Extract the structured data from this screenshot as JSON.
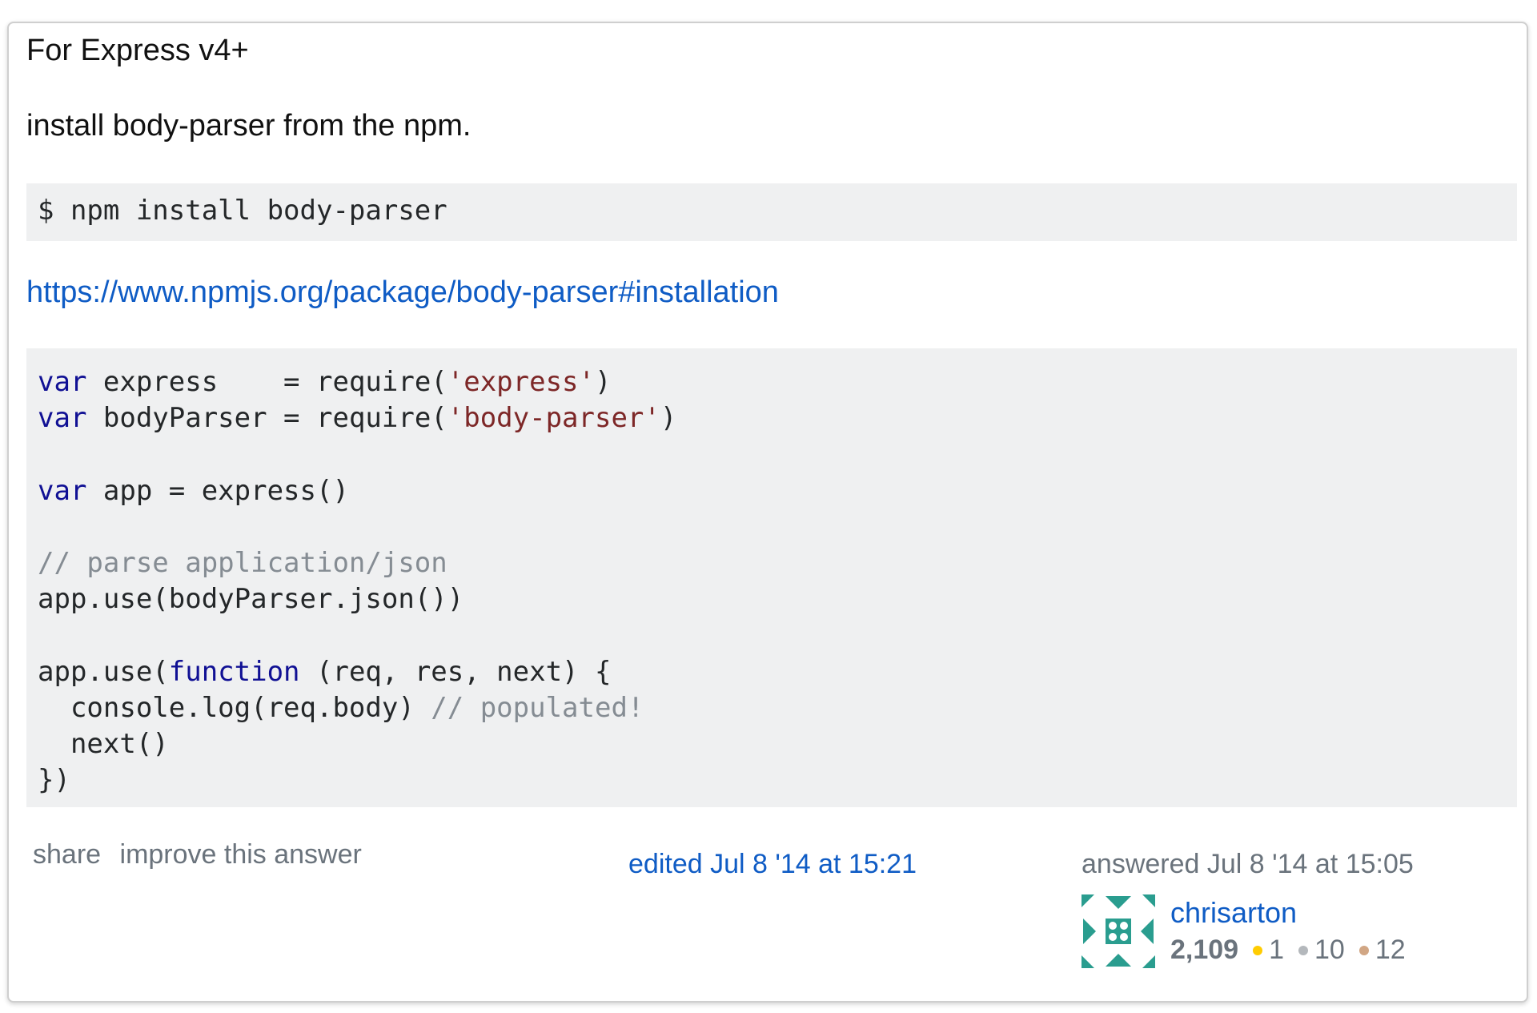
{
  "answer": {
    "heading": "For Express v4+",
    "intro": "install body-parser from the npm.",
    "install_command": "$ npm install body-parser",
    "link_text": "https://www.npmjs.org/package/body-parser#installation",
    "code": {
      "line1_kw": "var",
      "line1_a": " express    = require(",
      "line1_str": "'express'",
      "line1_b": ")",
      "line2_kw": "var",
      "line2_a": " bodyParser = require(",
      "line2_str": "'body-parser'",
      "line2_b": ")",
      "line4_kw": "var",
      "line4_a": " app = express()",
      "line6_cmt": "// parse application/json",
      "line7": "app.use(bodyParser.json())",
      "line9_a": "app.use(",
      "line9_kw": "function",
      "line9_b": " (req, res, next) {",
      "line10_a": "  console.log(req.body) ",
      "line10_cmt": "// populated!",
      "line11": "  next()",
      "line12": "})"
    }
  },
  "post_menu": {
    "share": "share",
    "improve": "improve this answer"
  },
  "edit_info": {
    "edited": "edited Jul 8 '14 at 15:21"
  },
  "owner": {
    "answered": "answered Jul 8 '14 at 15:05",
    "username": "chrisarton",
    "reputation": "2,109",
    "gold": "1",
    "silver": "10",
    "bronze": "12"
  },
  "colors": {
    "link": "#0f5cc5",
    "gold": "#ffcc01",
    "silver": "#b4b8bc",
    "bronze": "#d1a684",
    "avatar": "#2a9d8f"
  }
}
